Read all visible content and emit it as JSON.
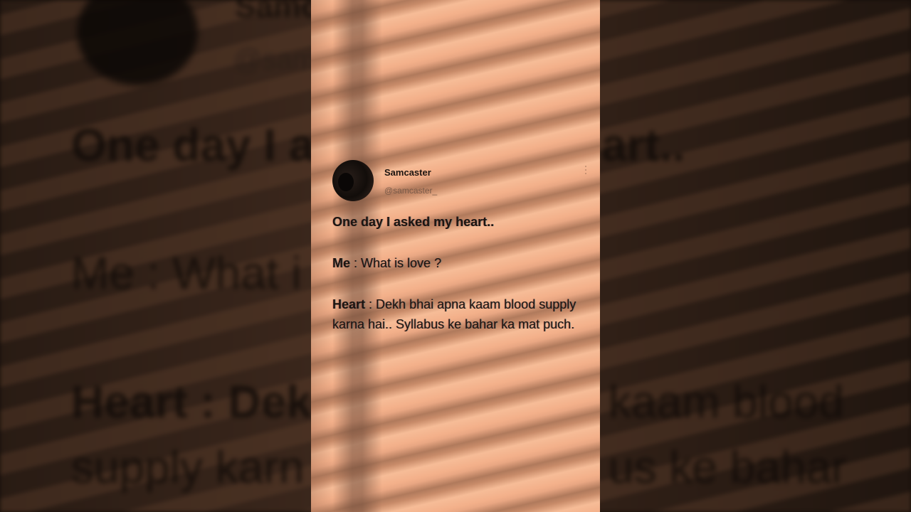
{
  "tweet": {
    "display_name": "Samcaster",
    "handle": "@samcaster_",
    "line1": "One day I asked my heart..",
    "me_speaker": "Me",
    "me_separator": " : ",
    "me_text": "What is love ?",
    "heart_speaker": "Heart",
    "heart_separator": " : ",
    "heart_text": "Dekh bhai apna kaam blood supply karna hai.. Syllabus ke bahar ka mat puch."
  },
  "background": {
    "handle_fragment": "@samc",
    "name_fragment": "Samc",
    "line1_left": "One day I a",
    "line1_right": "art..",
    "me_left": "Me : What i",
    "heart_left": "Heart : Dek",
    "heart_right": "kaam blood",
    "supply_left": "supply karn",
    "supply_right": "us ke bahar"
  },
  "colors": {
    "panel_light": "#f3b08a",
    "panel_shadow": "#b07a5c",
    "text": "#1c1410",
    "background": "#1b120d"
  }
}
